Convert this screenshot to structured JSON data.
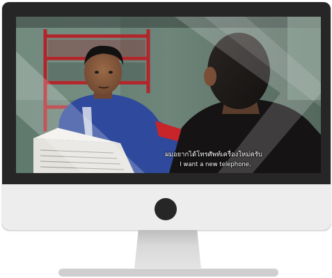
{
  "video": {
    "subtitle_thai": "ผมอยากได้โทรศัพท์เครื่องใหม่ครับ",
    "subtitle_english": "I want a new telephone."
  },
  "colors": {
    "monitor_frame": "#262626",
    "monitor_chin": "#ededed",
    "stand": "#d6d6d6",
    "subtitle_text": "#ffffff"
  },
  "icons": {
    "logo": "circle-logo-icon"
  }
}
